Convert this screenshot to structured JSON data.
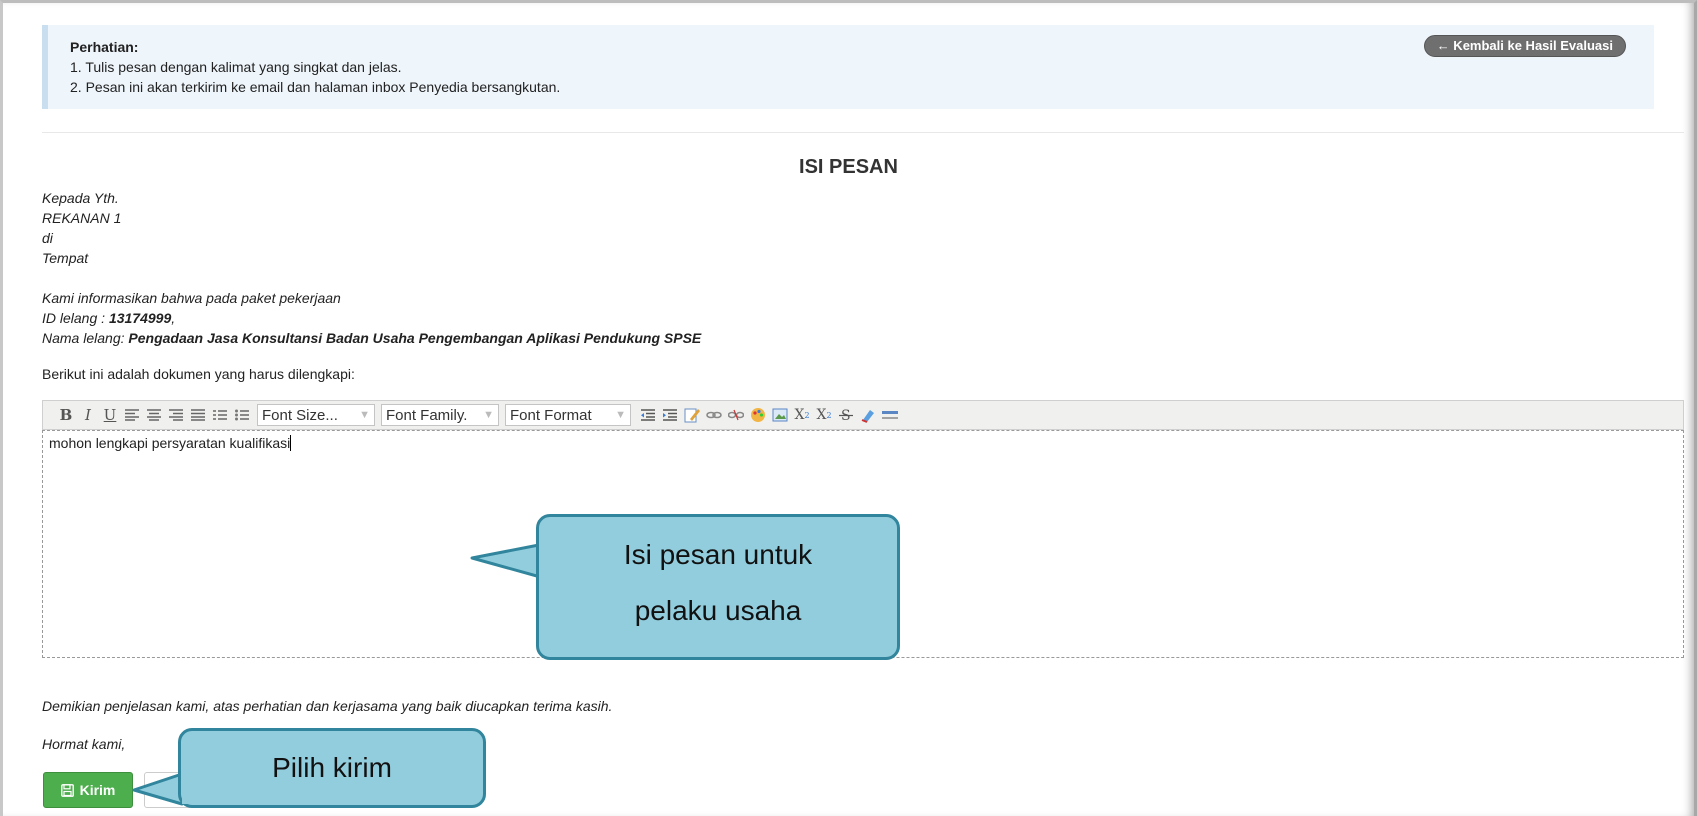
{
  "notice": {
    "title": "Perhatian:",
    "line1": "1. Tulis pesan dengan kalimat yang singkat dan jelas.",
    "line2": "2. Pesan ini akan terkirim ke email dan halaman inbox Penyedia bersangkutan.",
    "back_button": "← Kembali ke Hasil Evaluasi"
  },
  "message": {
    "heading": "ISI PESAN",
    "salutation": [
      "Kepada Yth.",
      "REKANAN 1",
      "di",
      "Tempat"
    ],
    "intro": "Kami informasikan bahwa pada paket pekerjaan",
    "id_label": "ID lelang : ",
    "id_value": "13174999",
    "id_suffix": ",",
    "name_label": "Nama lelang: ",
    "name_value": "Pengadaan Jasa Konsultansi Badan Usaha Pengembangan Aplikasi Pendukung SPSE",
    "docs_intro": "Berikut ini adalah dokumen yang harus dilengkapi:",
    "closing": "Demikian penjelasan kami, atas perhatian dan kerjasama yang baik diucapkan terima kasih.",
    "signoff": "Hormat kami,"
  },
  "editor": {
    "toolbar": {
      "bold": "B",
      "italic": "I",
      "underline": "U",
      "font_size": "Font Size...",
      "font_family": "Font Family.",
      "font_format": "Font Format",
      "subscript": "X",
      "superscript": "X"
    },
    "content": "mohon lengkapi persyaratan kualifikasi"
  },
  "actions": {
    "send_label": "Kirim"
  },
  "annotations": {
    "message_callout_line1": "Isi pesan untuk",
    "message_callout_line2": "pelaku usaha",
    "send_callout": "Pilih kirim"
  },
  "colors": {
    "notice_bg": "#eef5fb",
    "callout_fill": "#92cddd",
    "callout_border": "#31859c",
    "send_button": "#4cae4c"
  }
}
